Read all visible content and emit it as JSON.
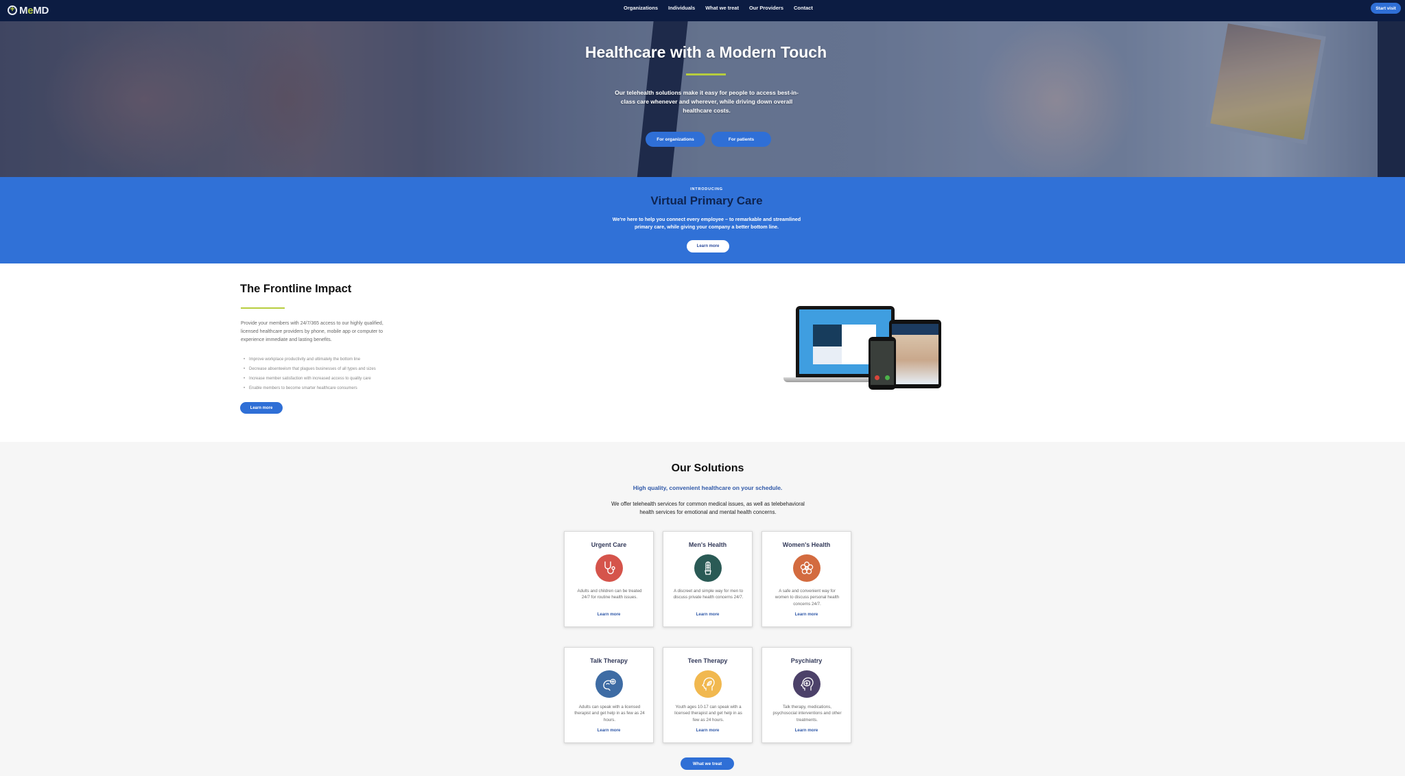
{
  "nav": {
    "logo": {
      "prefix": "M",
      "accent": "e",
      "suffix": "MD"
    },
    "links": [
      "Organizations",
      "Individuals",
      "What we treat",
      "Our Providers",
      "Contact"
    ],
    "cta": "Start visit"
  },
  "hero": {
    "title": "Healthcare with a Modern Touch",
    "description": "Our telehealth solutions make it easy for people to access best-in-class care whenever and wherever, while driving down overall healthcare costs.",
    "buttons": [
      "For organizations",
      "For patients"
    ]
  },
  "vpc": {
    "eyebrow": "INTRODUCING",
    "title": "Virtual Primary Care",
    "description": "We're here to help you connect every employee – to remarkable and streamlined primary care, while giving your company a better bottom line.",
    "button": "Learn more"
  },
  "frontline": {
    "title": "The Frontline Impact",
    "description": "Provide your members with 24/7/365 access to our highly qualified, licensed healthcare providers by phone, mobile app or computer to experience immediate and lasting benefits.",
    "bullets": [
      "Improve workplace productivity and ultimately the bottom line",
      "Decrease absenteeism that plagues businesses of all types and sizes",
      "Increase member satisfaction with increased access to quality care",
      "Enable members to become smarter healthcare consumers"
    ],
    "button": "Learn more"
  },
  "solutions": {
    "title": "Our Solutions",
    "subtitle": "High quality, convenient healthcare on your schedule.",
    "description": "We offer telehealth services for common medical issues, as well as telebehavioral health services for emotional and mental health concerns.",
    "cards": [
      {
        "title": "Urgent Care",
        "icon": "stethoscope-icon",
        "color": "#d5544b",
        "description": "Adults and children can be treated 24/7 for routine health issues.",
        "link": "Learn more"
      },
      {
        "title": "Men's Health",
        "icon": "cactus-icon",
        "color": "#2a5a55",
        "description": "A discreet and simple way for men to discuss private health concerns 24/7.",
        "link": "Learn more"
      },
      {
        "title": "Women's Health",
        "icon": "flower-icon",
        "color": "#d36b3f",
        "description": "A safe and convenient way for women to discuss personal health concerns 24/7.",
        "link": "Learn more"
      },
      {
        "title": "Talk Therapy",
        "icon": "talk-head-icon",
        "color": "#3e6ca4",
        "description": "Adults can speak with a licensed therapist and get help in as few as 24 hours.",
        "link": "Learn more"
      },
      {
        "title": "Teen Therapy",
        "icon": "leaf-head-icon",
        "color": "#f1b84f",
        "description": "Youth ages 10-17 can speak with a licensed therapist and get help in as few as 24 hours.",
        "link": "Learn more"
      },
      {
        "title": "Psychiatry",
        "icon": "brain-head-icon",
        "color": "#4c4169",
        "description": "Talk therapy, medications, psychosocial interventions and other treatments.",
        "link": "Learn more"
      }
    ],
    "button": "What we treat"
  }
}
